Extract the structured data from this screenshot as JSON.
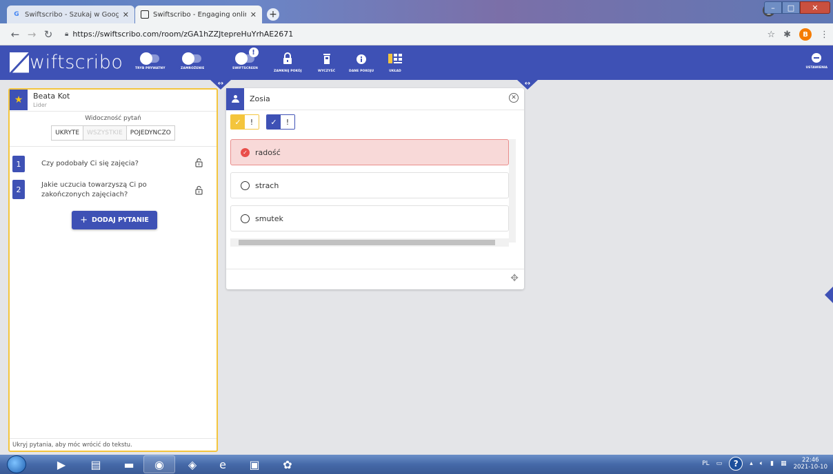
{
  "browser": {
    "tabs": [
      {
        "title": "Swiftscribo - Szukaj w Google",
        "favicon": "google-icon"
      },
      {
        "title": "Swiftscribo - Engaging online cla",
        "favicon": "swiftscribo-icon"
      }
    ],
    "url": "https://swiftscribo.com/room/zGA1hZZJtepreHuYrhAE2671",
    "profile_initial": "B"
  },
  "app": {
    "logo_text": "wiftscribo",
    "tools": [
      {
        "label": "TRYB PRYWATNY",
        "icon": "toggle"
      },
      {
        "label": "ZAMROŻENIE",
        "icon": "toggle"
      },
      {
        "label": "SWIFTSCREEN",
        "icon": "toggle",
        "badge": "!"
      },
      {
        "label": "ZAMKNIJ POKÓJ",
        "icon": "lock-icon"
      },
      {
        "label": "WYCZYŚĆ",
        "icon": "trash-icon"
      },
      {
        "label": "DANE POKOJU",
        "icon": "info-icon"
      },
      {
        "label": "UKŁAD",
        "icon": "layout-icon"
      }
    ],
    "settings_label": "USTAWIENIA",
    "accent": "#3e51b5",
    "highlight": "#f4c53c"
  },
  "leader_panel": {
    "name": "Beata Kot",
    "role": "Lider",
    "visibility_label": "Widoczność pytań",
    "visibility_options": [
      "UKRYTE",
      "WSZYSTKIE",
      "POJEDYNCZO"
    ],
    "questions": [
      {
        "number": "1",
        "text": "Czy podobały Ci się zajęcia?"
      },
      {
        "number": "2",
        "text": "Jakie uczucia towarzyszą Ci po zakończonych zajęciach?"
      }
    ],
    "add_button": "DODAJ PYTANIE",
    "footer": "Ukryj pytania, aby móc wrócić do tekstu."
  },
  "student_panel": {
    "name": "Zosia",
    "flags": [
      {
        "check": "✓",
        "mark": "!",
        "color": "#f4c53c"
      },
      {
        "check": "✓",
        "mark": "!",
        "color": "#3e51b5"
      }
    ],
    "answers": [
      {
        "text": "radość",
        "selected": true
      },
      {
        "text": "strach",
        "selected": false
      },
      {
        "text": "smutek",
        "selected": false
      }
    ]
  },
  "taskbar": {
    "language": "PL",
    "time": "22:46",
    "date": "2021-10-10"
  }
}
